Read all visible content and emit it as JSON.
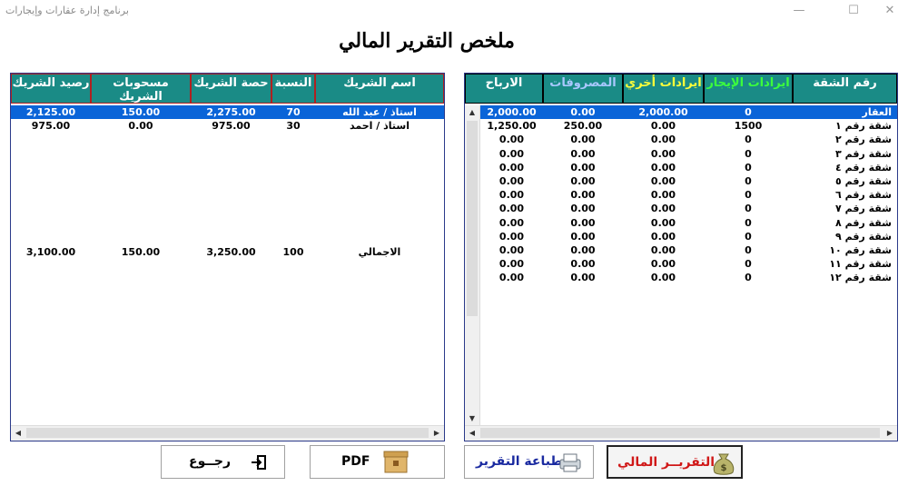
{
  "app_title": "برنامج إدارة عقارات وإيجارات",
  "window_controls": {
    "minimize": "—",
    "maximize": "☐",
    "close": "✕"
  },
  "report_title": "ملخص التقرير المالي",
  "partners": {
    "headers": {
      "balance": "رصيد الشريك",
      "withdrawals": "مسحوبات الشريك",
      "share": "حصة الشريك",
      "ratio": "النسبة",
      "name": "اسم الشريك"
    },
    "rows": [
      {
        "balance": "2,125.00",
        "withdrawals": "150.00",
        "share": "2,275.00",
        "ratio": "70",
        "name": "استاذ / عبد الله"
      },
      {
        "balance": "975.00",
        "withdrawals": "0.00",
        "share": "975.00",
        "ratio": "30",
        "name": "استاذ / احمد"
      }
    ],
    "total": {
      "balance": "3,100.00",
      "withdrawals": "150.00",
      "share": "3,250.00",
      "ratio": "100",
      "name": "الاجمالي"
    }
  },
  "apartments": {
    "headers": {
      "profits": "الارباح",
      "expenses": "المصروفات",
      "other_income": "ايرادات أخري",
      "rent_income": "ايرادات الإيجار",
      "unit": "رقم الشقة"
    },
    "header_colors": {
      "profits": "#ffffff",
      "expenses": "#a9c8ff",
      "other_income": "#ffff3a",
      "rent_income": "#3cff3c",
      "unit": "#ffffff"
    },
    "rows": [
      {
        "profits": "2,000.00",
        "expenses": "0.00",
        "other_income": "2,000.00",
        "rent_income": "0",
        "unit": "العقار"
      },
      {
        "profits": "1,250.00",
        "expenses": "250.00",
        "other_income": "0.00",
        "rent_income": "1500",
        "unit": "شقة رقم ١"
      },
      {
        "profits": "0.00",
        "expenses": "0.00",
        "other_income": "0.00",
        "rent_income": "0",
        "unit": "شقة رقم ٢"
      },
      {
        "profits": "0.00",
        "expenses": "0.00",
        "other_income": "0.00",
        "rent_income": "0",
        "unit": "شقة رقم ٣"
      },
      {
        "profits": "0.00",
        "expenses": "0.00",
        "other_income": "0.00",
        "rent_income": "0",
        "unit": "شقة رقم ٤"
      },
      {
        "profits": "0.00",
        "expenses": "0.00",
        "other_income": "0.00",
        "rent_income": "0",
        "unit": "شقة رقم ٥"
      },
      {
        "profits": "0.00",
        "expenses": "0.00",
        "other_income": "0.00",
        "rent_income": "0",
        "unit": "شقة رقم ٦"
      },
      {
        "profits": "0.00",
        "expenses": "0.00",
        "other_income": "0.00",
        "rent_income": "0",
        "unit": "شقة رقم ٧"
      },
      {
        "profits": "0.00",
        "expenses": "0.00",
        "other_income": "0.00",
        "rent_income": "0",
        "unit": "شقة رقم ٨"
      },
      {
        "profits": "0.00",
        "expenses": "0.00",
        "other_income": "0.00",
        "rent_income": "0",
        "unit": "شقة رقم ٩"
      },
      {
        "profits": "0.00",
        "expenses": "0.00",
        "other_income": "0.00",
        "rent_income": "0",
        "unit": "شقة رقم ١٠"
      },
      {
        "profits": "0.00",
        "expenses": "0.00",
        "other_income": "0.00",
        "rent_income": "0",
        "unit": "شقة رقم ١١"
      },
      {
        "profits": "0.00",
        "expenses": "0.00",
        "other_income": "0.00",
        "rent_income": "0",
        "unit": "شقة رقم ١٢"
      }
    ]
  },
  "buttons": {
    "back": "رجــوع",
    "pdf": "PDF",
    "print": "طباعة التقرير",
    "financial_report": "التقريــر المالي"
  },
  "colors": {
    "header_bg": "#1a8b86",
    "selection": "#0a64d8",
    "panel_border": "#2b3a8a",
    "report_button_text": "#d01818",
    "print_button_text": "#1a2aa0"
  }
}
